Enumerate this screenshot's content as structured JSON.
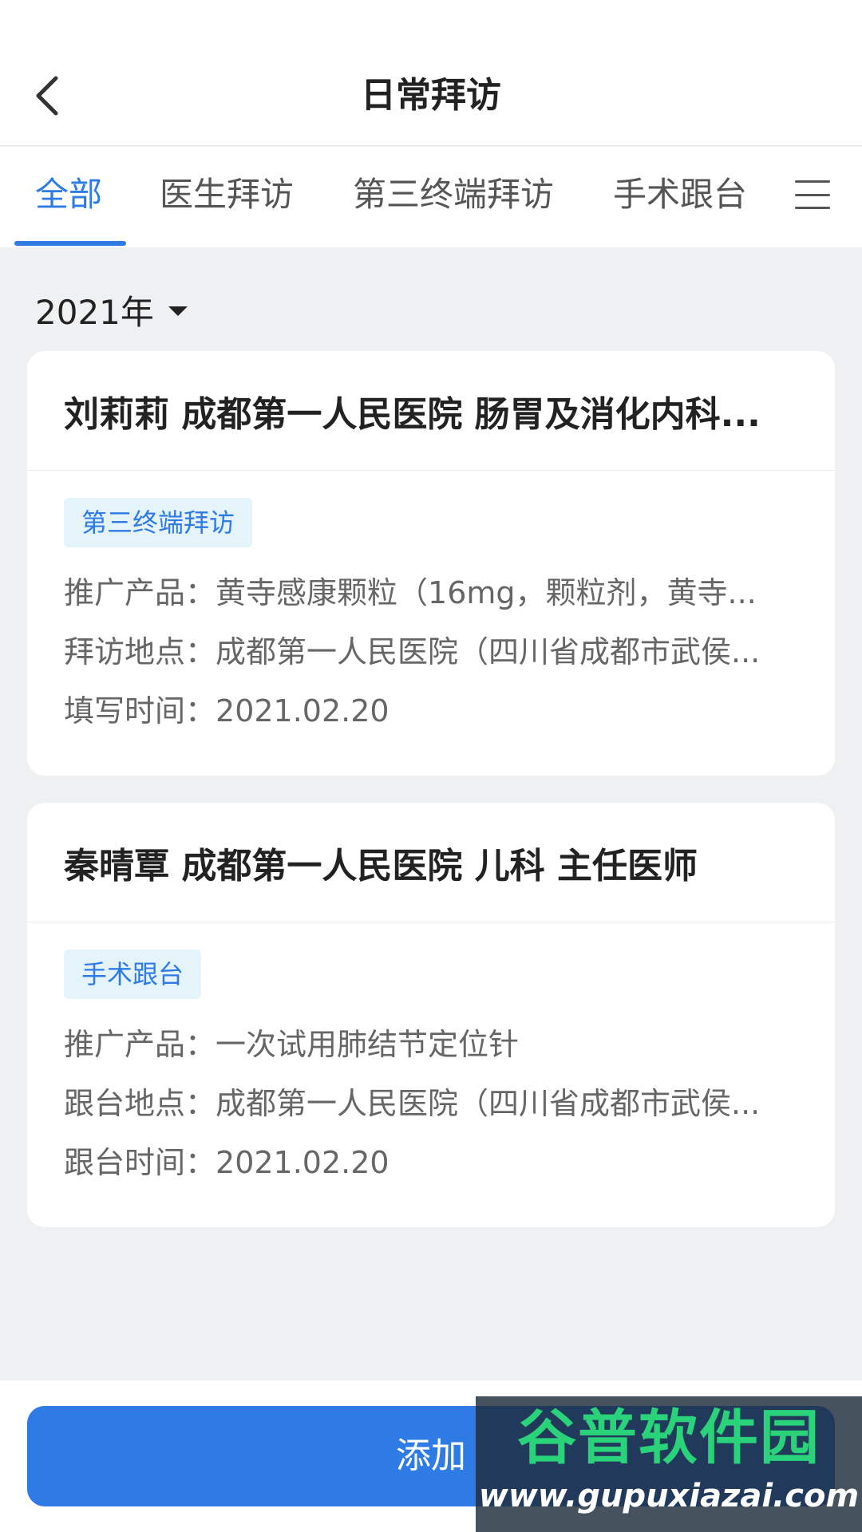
{
  "header": {
    "title": "日常拜访",
    "back_icon": "chevron-left-icon"
  },
  "tabs": [
    {
      "label": "全部",
      "active": true
    },
    {
      "label": "医生拜访",
      "active": false
    },
    {
      "label": "第三终端拜访",
      "active": false
    },
    {
      "label": "手术跟台",
      "active": false
    }
  ],
  "tab_menu_icon": "hamburger-menu-icon",
  "filter": {
    "year": "2021年",
    "dropdown_icon": "caret-down-icon"
  },
  "cards": [
    {
      "title": "刘莉莉 成都第一人民医院 肠胃及消化内科...",
      "tag": "第三终端拜访",
      "rows": [
        {
          "label": "推广产品：",
          "value": "黄寺感康颗粒（16mg，颗粒剂，黄寺..."
        },
        {
          "label": "拜访地点：",
          "value": "成都第一人民医院（四川省成都市武侯..."
        },
        {
          "label": "填写时间：",
          "value": "2021.02.20"
        }
      ]
    },
    {
      "title": "秦晴覃 成都第一人民医院 儿科 主任医师",
      "tag": "手术跟台",
      "rows": [
        {
          "label": "推广产品：",
          "value": "一次试用肺结节定位针"
        },
        {
          "label": "跟台地点：",
          "value": "成都第一人民医院（四川省成都市武侯..."
        },
        {
          "label": "跟台时间：",
          "value": "2021.02.20"
        }
      ]
    }
  ],
  "add_button": "添加",
  "watermark": {
    "logo": "谷普软件园",
    "url": "www.gupuxiazai.com"
  },
  "colors": {
    "accent": "#2f7be6",
    "background": "#eff0f2",
    "tag_bg": "#e5f3fb"
  }
}
